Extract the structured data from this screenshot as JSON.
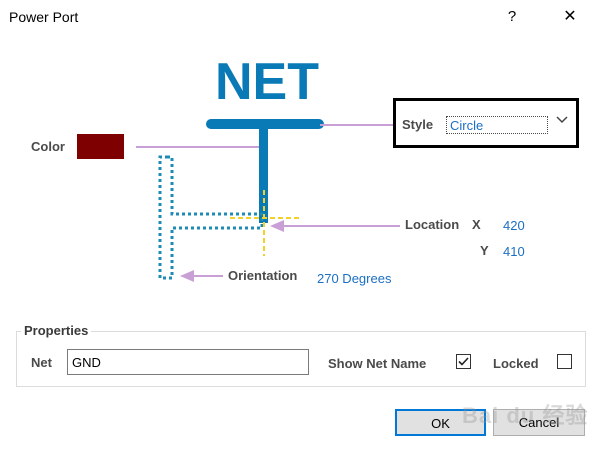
{
  "window": {
    "title": "Power Port",
    "help_label": "?",
    "close_label": "✕"
  },
  "diagram": {
    "net_text": "NET",
    "colors": {
      "port": "#0a7ab6",
      "callout": "#c9a0d6",
      "hotspot": "#f2d12b",
      "teal_dots": "#1d8bb5"
    }
  },
  "color": {
    "label": "Color",
    "value": "#7f0000"
  },
  "style": {
    "label": "Style",
    "value": "Circle",
    "dropdown_icon": "chevron-down"
  },
  "location": {
    "label": "Location",
    "x_label": "X",
    "x_value": "420",
    "y_label": "Y",
    "y_value": "410"
  },
  "orientation": {
    "label": "Orientation",
    "value": "270 Degrees"
  },
  "properties": {
    "title": "Properties",
    "net_label": "Net",
    "net_value": "GND",
    "show_net_name_label": "Show Net Name",
    "show_net_name_checked": true,
    "locked_label": "Locked",
    "locked_checked": false
  },
  "buttons": {
    "ok": "OK",
    "cancel": "Cancel"
  },
  "watermark": "Bai du 经验"
}
